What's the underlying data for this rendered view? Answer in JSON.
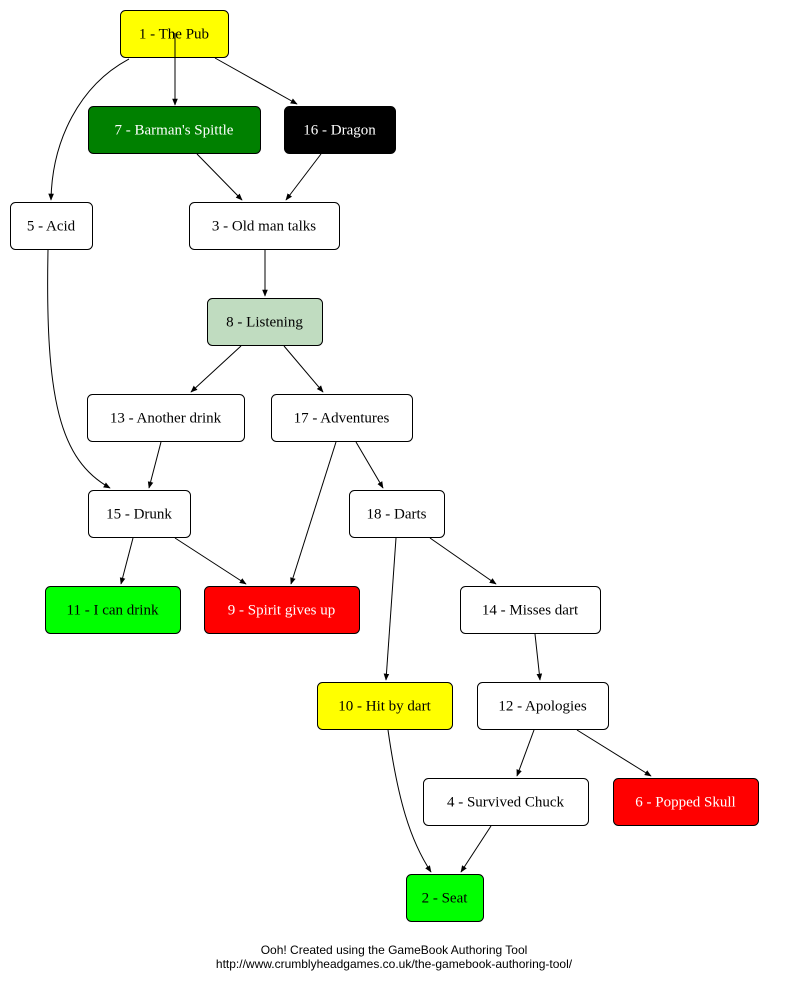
{
  "nodes": [
    {
      "id": "1",
      "label": "1 - The Pub",
      "fill": "#ffff00",
      "text": "#000000"
    },
    {
      "id": "7",
      "label": "7 - Barman's Spittle",
      "fill": "#008000",
      "text": "#ffffff"
    },
    {
      "id": "16",
      "label": "16 - Dragon",
      "fill": "#000000",
      "text": "#ffffff"
    },
    {
      "id": "5",
      "label": "5 - Acid",
      "fill": "#ffffff",
      "text": "#000000"
    },
    {
      "id": "3",
      "label": "3 - Old man talks",
      "fill": "#ffffff",
      "text": "#000000"
    },
    {
      "id": "8",
      "label": "8 - Listening",
      "fill": "#c0dcc0",
      "text": "#000000"
    },
    {
      "id": "13",
      "label": "13 - Another drink",
      "fill": "#ffffff",
      "text": "#000000"
    },
    {
      "id": "17",
      "label": "17 - Adventures",
      "fill": "#ffffff",
      "text": "#000000"
    },
    {
      "id": "15",
      "label": "15 - Drunk",
      "fill": "#ffffff",
      "text": "#000000"
    },
    {
      "id": "18",
      "label": "18 - Darts",
      "fill": "#ffffff",
      "text": "#000000"
    },
    {
      "id": "11",
      "label": "11 - I can drink",
      "fill": "#00ff00",
      "text": "#000000"
    },
    {
      "id": "9",
      "label": "9 - Spirit gives up",
      "fill": "#ff0000",
      "text": "#ffffff"
    },
    {
      "id": "14",
      "label": "14 - Misses dart",
      "fill": "#ffffff",
      "text": "#000000"
    },
    {
      "id": "10",
      "label": "10 - Hit by dart",
      "fill": "#ffff00",
      "text": "#000000"
    },
    {
      "id": "12",
      "label": "12 - Apologies",
      "fill": "#ffffff",
      "text": "#000000"
    },
    {
      "id": "4",
      "label": "4 - Survived Chuck",
      "fill": "#ffffff",
      "text": "#000000"
    },
    {
      "id": "6",
      "label": "6 - Popped Skull",
      "fill": "#ff0000",
      "text": "#ffffff"
    },
    {
      "id": "2",
      "label": "2 - Seat",
      "fill": "#00ff00",
      "text": "#000000"
    }
  ],
  "edges": [
    [
      "1",
      "7"
    ],
    [
      "1",
      "16"
    ],
    [
      "1",
      "5"
    ],
    [
      "7",
      "3"
    ],
    [
      "16",
      "3"
    ],
    [
      "5",
      "15"
    ],
    [
      "3",
      "8"
    ],
    [
      "8",
      "13"
    ],
    [
      "8",
      "17"
    ],
    [
      "13",
      "15"
    ],
    [
      "15",
      "11"
    ],
    [
      "15",
      "9"
    ],
    [
      "17",
      "9"
    ],
    [
      "17",
      "18"
    ],
    [
      "18",
      "10"
    ],
    [
      "18",
      "14"
    ],
    [
      "14",
      "12"
    ],
    [
      "12",
      "4"
    ],
    [
      "12",
      "6"
    ],
    [
      "10",
      "2"
    ],
    [
      "4",
      "2"
    ]
  ],
  "footer": {
    "line1": "Ooh! Created using the GameBook Authoring Tool",
    "line2": "http://www.crumblyheadgames.co.uk/the-gamebook-authoring-tool/"
  }
}
